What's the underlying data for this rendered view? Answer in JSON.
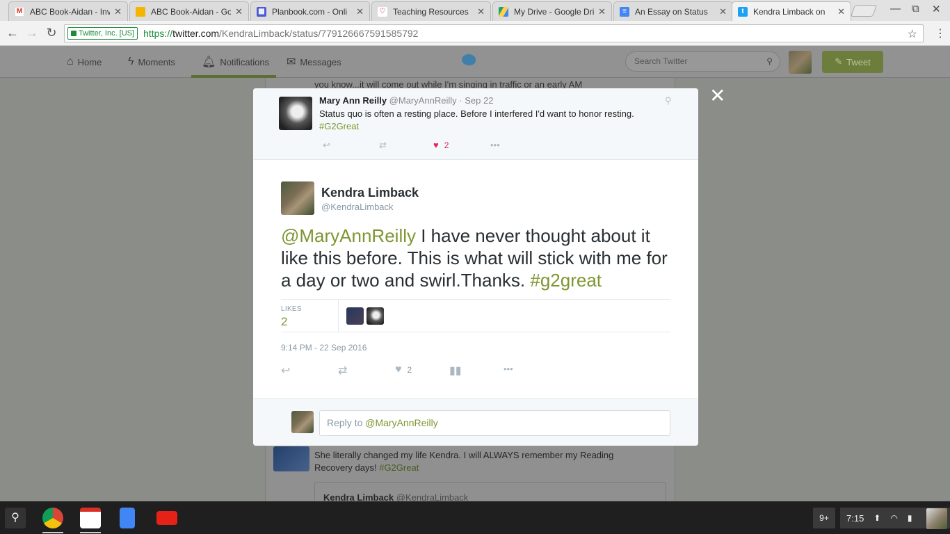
{
  "browser": {
    "tabs": [
      {
        "title": "ABC Book-Aidan - Inv",
        "icon": "gmail-icon",
        "color": "#d93025"
      },
      {
        "title": "ABC Book-Aidan - Go",
        "icon": "slides-icon",
        "color": "#f4b400"
      },
      {
        "title": "Planbook.com - Onli",
        "icon": "planbook-icon",
        "color": "#4a5bd4"
      },
      {
        "title": "Teaching Resources",
        "icon": "tpt-icon",
        "color": "#e38c9a"
      },
      {
        "title": "My Drive - Google Dri",
        "icon": "drive-icon",
        "color": "#1fa463"
      },
      {
        "title": "An Essay on Status",
        "icon": "docs-icon",
        "color": "#4285f4"
      },
      {
        "title": "Kendra Limback on",
        "icon": "twitter-icon",
        "color": "#1da1f2"
      }
    ],
    "active_tab": 6,
    "security_label": "Twitter, Inc. [US]",
    "url_scheme": "https://",
    "url_host": "twitter.com",
    "url_path": "/KendraLimback/status/779126667591585792"
  },
  "twitter_nav": {
    "home": "Home",
    "moments": "Moments",
    "notifications": "Notifications",
    "messages": "Messages",
    "search_placeholder": "Search Twitter",
    "tweet_button": "Tweet"
  },
  "background": {
    "top_text": "you know...it will come out while I'm singing in traffic or an early AM",
    "reply_text": "She literally changed my life Kendra. I will ALWAYS remember my Reading Recovery days!",
    "reply_hashtag": "#G2Great",
    "quote_name": "Kendra Limback",
    "quote_handle": "@KendraLimback"
  },
  "modal": {
    "ancestor": {
      "name": "Mary Ann Reilly",
      "handle": "@MaryAnnReilly",
      "date": "· Sep 22",
      "text": "Status quo is often a resting place. Before I interfered I'd want to honor resting.",
      "hashtag": "#G2Great",
      "likes": "2"
    },
    "tweet": {
      "name": "Kendra Limback",
      "handle": "@KendraLimback",
      "mention": "@MaryAnnReilly",
      "text": " I have never thought about it like this before.  This is what will stick with me for a day or two and swirl.Thanks.  ",
      "hashtag": "#g2great",
      "likes_label": "LIKES",
      "likes_count": "2",
      "timestamp": "9:14 PM - 22 Sep 2016",
      "action_likes": "2"
    },
    "reply": {
      "prefix": "Reply to ",
      "mention": "@MaryAnnReilly"
    }
  },
  "shelf": {
    "notifications_badge": "9+",
    "time": "7:15",
    "apps": [
      "chrome-icon",
      "gmail-icon",
      "docs-icon",
      "youtube-icon"
    ]
  }
}
